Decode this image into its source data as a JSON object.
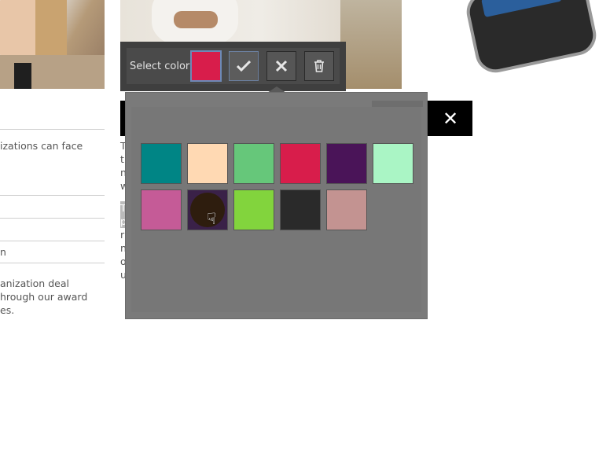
{
  "toolbar": {
    "select_label": "Select color",
    "current_color": "#d81d4b",
    "icons": [
      "check-icon",
      "close-icon",
      "trash-icon"
    ]
  },
  "palette": {
    "colors": [
      "#008585",
      "#ffd9b3",
      "#66c77a",
      "#d81d4b",
      "#4a1458",
      "#aaf5c5",
      "#c55b97",
      "#3a2148",
      "#82d43d",
      "#2a2a2a",
      "#c39391"
    ],
    "hovered_index": 7
  },
  "background": {
    "left_lines": [
      "izations can face",
      "n",
      "anization deal",
      "hrough our award",
      "es."
    ],
    "mid_chars": [
      "T",
      "t",
      "n",
      "w",
      "T",
      "p",
      "r",
      "n",
      "o",
      "u"
    ],
    "header_close": "✕"
  }
}
